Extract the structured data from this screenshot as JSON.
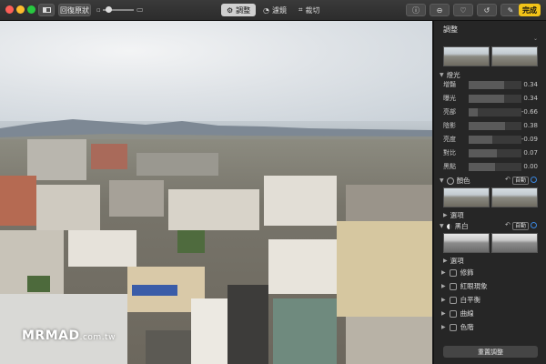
{
  "toolbar": {
    "original_label": "回復原狀",
    "tabs": [
      {
        "label": "調整",
        "icon": "sliders-icon",
        "active": true
      },
      {
        "label": "濾鏡",
        "icon": "filter-icon",
        "active": false
      },
      {
        "label": "裁切",
        "icon": "crop-icon",
        "active": false
      }
    ],
    "done_label": "完成"
  },
  "photo": {
    "watermark_main": "MRMAD",
    "watermark_sub": ".com.tw"
  },
  "panel": {
    "title": "調整",
    "light_section": "燈光",
    "light_rows": [
      {
        "label": "增豔",
        "value": "0.34",
        "fill": 0.67
      },
      {
        "label": "曝光",
        "value": "0.34",
        "fill": 0.67
      },
      {
        "label": "亮部",
        "value": "-0.66",
        "fill": 0.17
      },
      {
        "label": "陰影",
        "value": "0.38",
        "fill": 0.69
      },
      {
        "label": "亮度",
        "value": "-0.09",
        "fill": 0.45
      },
      {
        "label": "對比",
        "value": "0.07",
        "fill": 0.53
      },
      {
        "label": "黑點",
        "value": "0.00",
        "fill": 0.5
      }
    ],
    "color_section": "顏色",
    "color_options": "選項",
    "bw_section": "黑白",
    "bw_options": "選項",
    "auto_label": "自動",
    "tools": [
      {
        "label": "修飾",
        "icon": "bandage-icon"
      },
      {
        "label": "紅眼現象",
        "icon": "eye-icon"
      },
      {
        "label": "白平衡",
        "icon": "white-balance-icon"
      },
      {
        "label": "曲線",
        "icon": "curves-icon"
      },
      {
        "label": "色階",
        "icon": "levels-icon"
      }
    ],
    "reset_label": "重置調整"
  },
  "colors": {
    "accent_done": "#f2c318",
    "toggle_blue": "#3b87e0"
  }
}
